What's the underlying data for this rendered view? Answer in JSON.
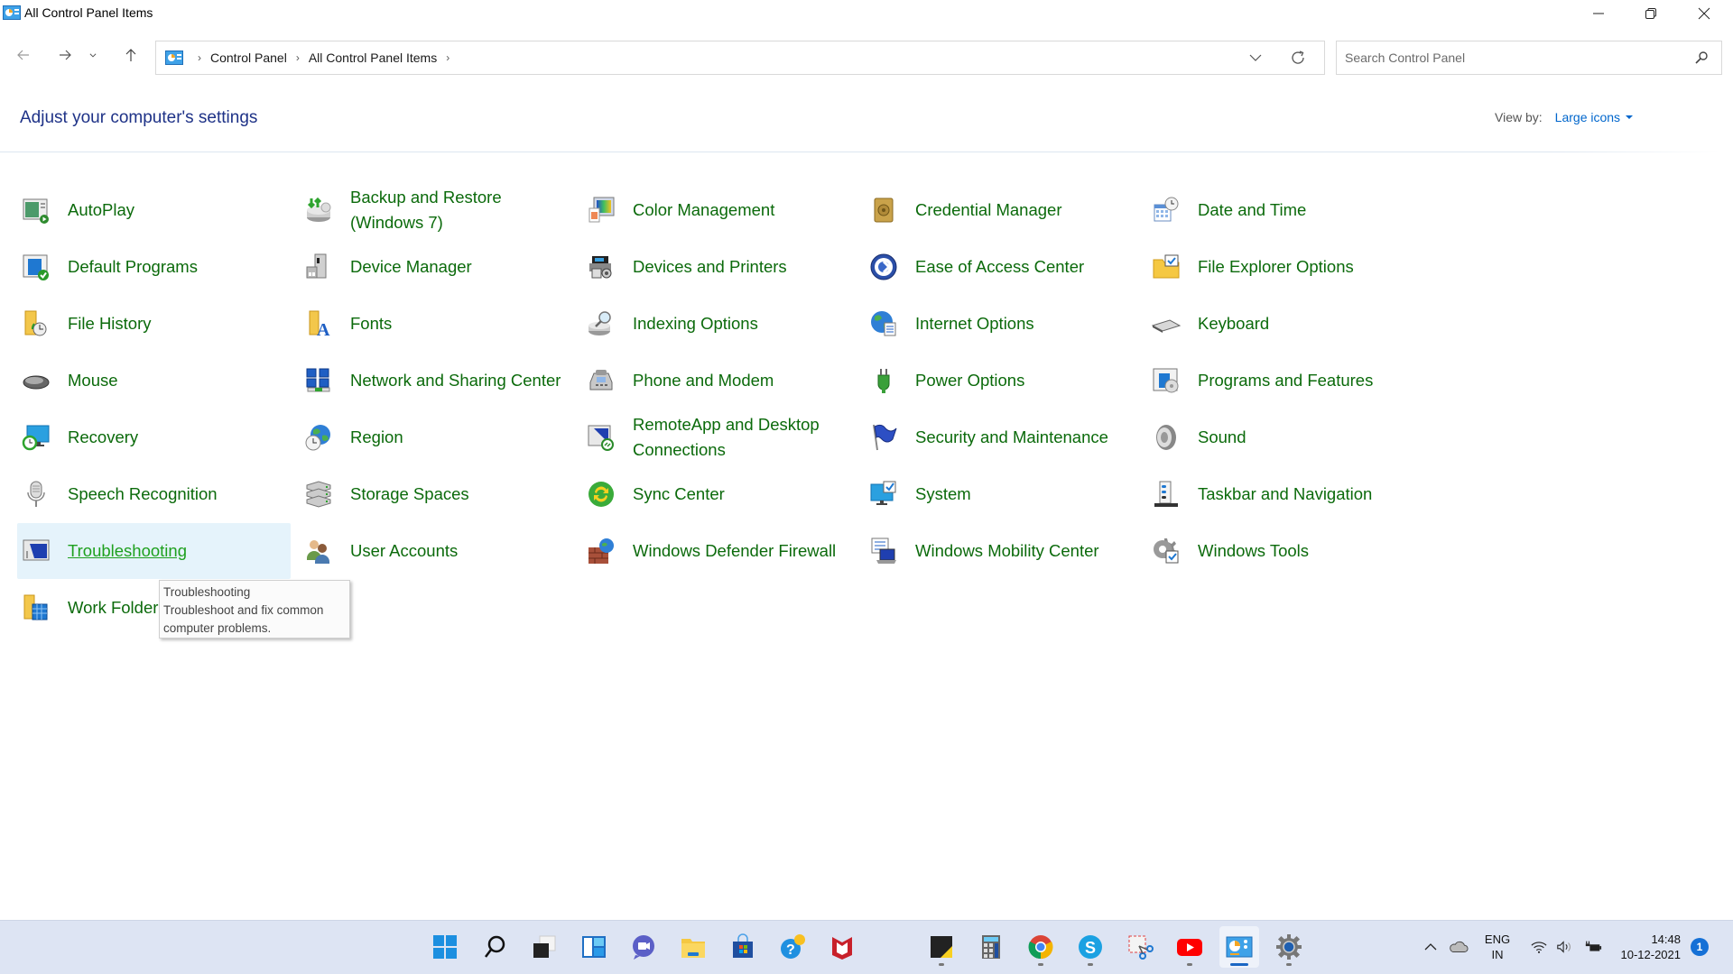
{
  "window": {
    "title": "All Control Panel Items",
    "controls": {
      "minimize": "minimize-icon",
      "restore": "restore-icon",
      "close": "close-icon"
    }
  },
  "navigation": {
    "back": "arrow-left-icon",
    "forward": "arrow-right-icon",
    "recent": "chevron-down-icon",
    "up": "arrow-up-icon",
    "breadcrumb": [
      "Control Panel",
      "All Control Panel Items"
    ],
    "refresh": "refresh-icon"
  },
  "search": {
    "placeholder": "Search Control Panel",
    "value": ""
  },
  "header": {
    "title": "Adjust your computer's settings",
    "view_by_label": "View by:",
    "view_by_value": "Large icons"
  },
  "items": [
    {
      "label": "AutoPlay",
      "icon": "autoplay-icon"
    },
    {
      "label": "Backup and Restore (Windows 7)",
      "icon": "backup-icon"
    },
    {
      "label": "Color Management",
      "icon": "color-management-icon"
    },
    {
      "label": "Credential Manager",
      "icon": "credential-safe-icon"
    },
    {
      "label": "Date and Time",
      "icon": "calendar-clock-icon"
    },
    {
      "label": "Default Programs",
      "icon": "default-programs-icon"
    },
    {
      "label": "Device Manager",
      "icon": "device-manager-icon"
    },
    {
      "label": "Devices and Printers",
      "icon": "printer-icon"
    },
    {
      "label": "Ease of Access Center",
      "icon": "ease-of-access-icon"
    },
    {
      "label": "File Explorer Options",
      "icon": "folder-options-icon"
    },
    {
      "label": "File History",
      "icon": "file-history-icon"
    },
    {
      "label": "Fonts",
      "icon": "fonts-icon"
    },
    {
      "label": "Indexing Options",
      "icon": "indexing-icon"
    },
    {
      "label": "Internet Options",
      "icon": "internet-options-icon"
    },
    {
      "label": "Keyboard",
      "icon": "keyboard-icon"
    },
    {
      "label": "Mouse",
      "icon": "mouse-icon"
    },
    {
      "label": "Network and Sharing Center",
      "icon": "network-icon"
    },
    {
      "label": "Phone and Modem",
      "icon": "phone-icon"
    },
    {
      "label": "Power Options",
      "icon": "power-plug-icon"
    },
    {
      "label": "Programs and Features",
      "icon": "programs-features-icon"
    },
    {
      "label": "Recovery",
      "icon": "recovery-icon"
    },
    {
      "label": "Region",
      "icon": "globe-clock-icon"
    },
    {
      "label": "RemoteApp and Desktop Connections",
      "icon": "remoteapp-icon"
    },
    {
      "label": "Security and Maintenance",
      "icon": "flag-icon"
    },
    {
      "label": "Sound",
      "icon": "speaker-icon"
    },
    {
      "label": "Speech Recognition",
      "icon": "microphone-icon"
    },
    {
      "label": "Storage Spaces",
      "icon": "storage-icon"
    },
    {
      "label": "Sync Center",
      "icon": "sync-icon"
    },
    {
      "label": "System",
      "icon": "monitor-check-icon"
    },
    {
      "label": "Taskbar and Navigation",
      "icon": "taskbar-icon"
    },
    {
      "label": "Troubleshooting",
      "icon": "troubleshooting-icon",
      "hovered": true
    },
    {
      "label": "User Accounts",
      "icon": "users-icon"
    },
    {
      "label": "Windows Defender Firewall",
      "icon": "firewall-icon"
    },
    {
      "label": "Windows Mobility Center",
      "icon": "mobility-icon"
    },
    {
      "label": "Windows Tools",
      "icon": "gear-check-icon"
    },
    {
      "label": "Work Folders",
      "icon": "work-folders-icon"
    }
  ],
  "tooltip": {
    "title": "Troubleshooting",
    "description": "Troubleshoot and fix common computer problems."
  },
  "taskbar": {
    "apps": [
      {
        "name": "start",
        "icon": "windows-start-icon",
        "running": false
      },
      {
        "name": "search",
        "icon": "search-icon",
        "running": false
      },
      {
        "name": "task-view",
        "icon": "task-view-icon",
        "running": false
      },
      {
        "name": "widgets",
        "icon": "widgets-icon",
        "running": false
      },
      {
        "name": "chat",
        "icon": "chat-icon",
        "running": false
      },
      {
        "name": "file-explorer",
        "icon": "folder-icon",
        "running": false
      },
      {
        "name": "microsoft-store",
        "icon": "store-icon",
        "running": false
      },
      {
        "name": "get-help",
        "icon": "help-icon",
        "running": false
      },
      {
        "name": "mcafee",
        "icon": "mcafee-icon",
        "running": false
      },
      {
        "name": "sticky-notes",
        "icon": "sticky-notes-icon",
        "running": true
      },
      {
        "name": "calculator",
        "icon": "calculator-icon",
        "running": false
      },
      {
        "name": "chrome",
        "icon": "chrome-icon",
        "running": true
      },
      {
        "name": "skype",
        "icon": "skype-icon",
        "running": true
      },
      {
        "name": "snipping-tool",
        "icon": "snipping-tool-icon",
        "running": false
      },
      {
        "name": "youtube",
        "icon": "youtube-icon",
        "running": true
      },
      {
        "name": "control-panel",
        "icon": "control-panel-icon",
        "running": true,
        "active": true
      },
      {
        "name": "settings",
        "icon": "settings-gear-icon",
        "running": true
      }
    ],
    "tray": {
      "language_line1": "ENG",
      "language_line2": "IN",
      "time": "14:48",
      "date": "10-12-2021",
      "notification_count": "1"
    }
  },
  "colors": {
    "link_green": "#0b6a0b",
    "heading_blue": "#1e3287",
    "view_by_blue": "#0066cc",
    "hover_bg": "#e5f3fb",
    "taskbar_bg": "#dde4f3"
  }
}
